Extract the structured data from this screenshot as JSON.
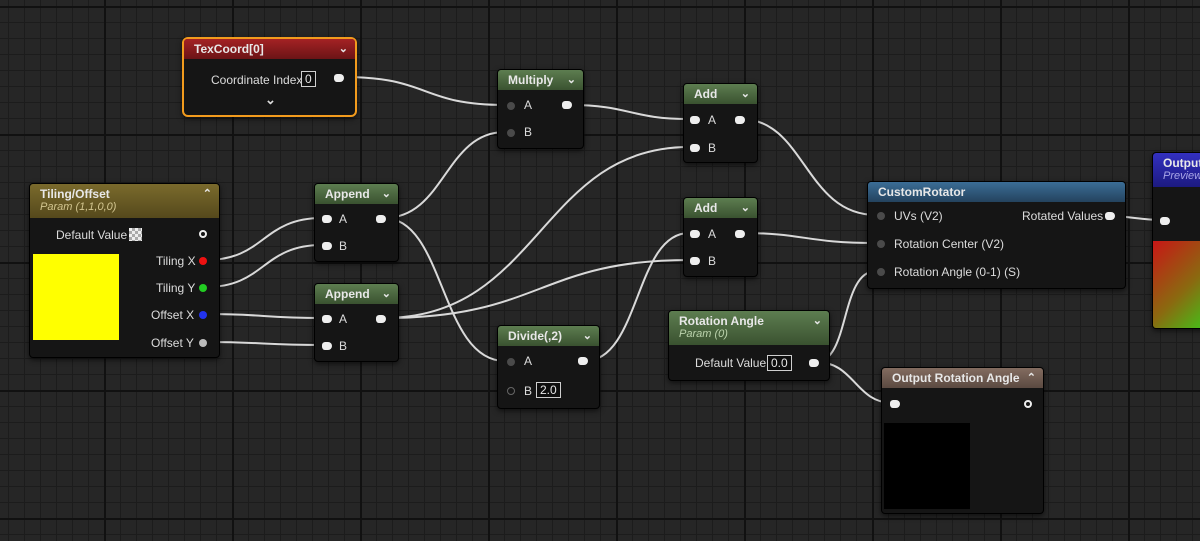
{
  "nodes": {
    "texcoord": {
      "title": "TexCoord[0]",
      "coord_label": "Coordinate Index",
      "coord_value": "0"
    },
    "tiling": {
      "title": "Tiling/Offset",
      "subtitle": "Param (1,1,0,0)",
      "default_label": "Default Value",
      "outputs": [
        "Tiling X",
        "Tiling Y",
        "Offset X",
        "Offset Y"
      ],
      "swatch_color": "#ffff00"
    },
    "append1": {
      "title": "Append",
      "in_a": "A",
      "in_b": "B"
    },
    "append2": {
      "title": "Append",
      "in_a": "A",
      "in_b": "B"
    },
    "multiply": {
      "title": "Multiply",
      "in_a": "A",
      "in_b": "B"
    },
    "divide": {
      "title": "Divide(,2)",
      "in_a": "A",
      "in_b": "B",
      "b_value": "2.0"
    },
    "add1": {
      "title": "Add",
      "in_a": "A",
      "in_b": "B"
    },
    "add2": {
      "title": "Add",
      "in_a": "A",
      "in_b": "B"
    },
    "rotation": {
      "title": "Rotation Angle",
      "subtitle": "Param (0)",
      "default_label": "Default Value",
      "value": "0.0"
    },
    "custom": {
      "title": "CustomRotator",
      "in_uvs": "UVs (V2)",
      "in_center": "Rotation Center (V2)",
      "in_angle": "Rotation Angle (0-1) (S)",
      "out": "Rotated Values"
    },
    "output_angle": {
      "title": "Output Rotation Angle",
      "preview_color": "#000000"
    },
    "output": {
      "title": "Output",
      "subtitle": "Preview"
    }
  },
  "colors": {
    "selection": "#f29b1d",
    "wire": "#d9d9d9",
    "pin_tiling_x": "#ee1111",
    "pin_tiling_y": "#22cc22",
    "pin_offset_x": "#2233ee",
    "pin_offset_y": "#bbbbbb"
  },
  "icons": [
    "chevron-down-icon",
    "chevron-up-icon",
    "checker-icon"
  ]
}
